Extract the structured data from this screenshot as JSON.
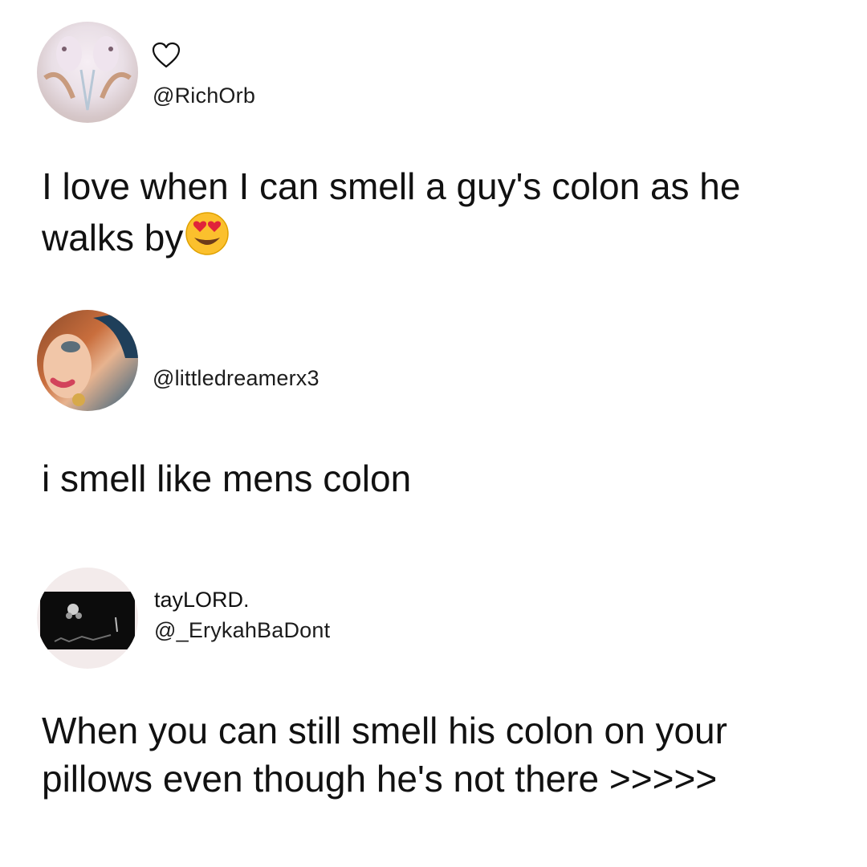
{
  "tweets": [
    {
      "display_name": "",
      "handle": "@RichOrb",
      "text": "I love when I can smell a guy's colon as he walks by",
      "emoji": "smiling-face-with-heart-eyes-icon",
      "badge_icon": "heart-outline-icon"
    },
    {
      "display_name": "",
      "handle": "@littledreamerx3",
      "text": "i smell like mens colon"
    },
    {
      "display_name": "tayLORD.",
      "handle": "@_ErykahBaDont",
      "text": "When you can still smell his colon on your pillows even though he's not there >>>>>"
    }
  ],
  "colors": {
    "background": "#ffffff",
    "text": "#111111",
    "heart_eyes": "#e0243a",
    "emoji_face": "#fbc02d"
  }
}
